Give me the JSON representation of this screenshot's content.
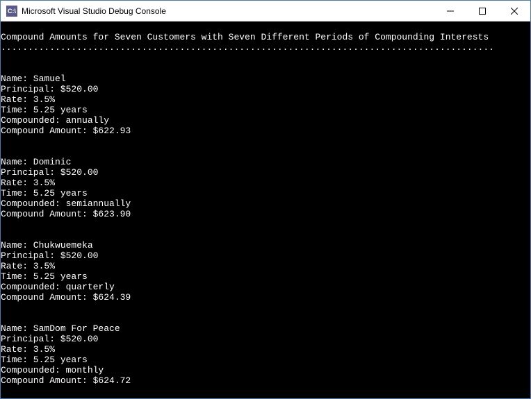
{
  "window": {
    "title": "Microsoft Visual Studio Debug Console",
    "icon_label": "C:\\"
  },
  "console": {
    "header": "Compound Amounts for Seven Customers with Seven Different Periods of Compounding Interests",
    "separator": "...........................................................................................",
    "labels": {
      "name": "Name: ",
      "principal": "Principal: ",
      "rate": "Rate: ",
      "time": "Time: ",
      "compounded": "Compounded: ",
      "amount": "Compound Amount: "
    },
    "customers": [
      {
        "name": "Samuel",
        "principal": "$520.00",
        "rate": "3.5%",
        "time": "5.25 years",
        "compounded": "annually",
        "amount": "$622.93"
      },
      {
        "name": "Dominic",
        "principal": "$520.00",
        "rate": "3.5%",
        "time": "5.25 years",
        "compounded": "semiannually",
        "amount": "$623.90"
      },
      {
        "name": "Chukwuemeka",
        "principal": "$520.00",
        "rate": "3.5%",
        "time": "5.25 years",
        "compounded": "quarterly",
        "amount": "$624.39"
      },
      {
        "name": "SamDom For Peace",
        "principal": "$520.00",
        "rate": "3.5%",
        "time": "5.25 years",
        "compounded": "monthly",
        "amount": "$624.72"
      }
    ]
  }
}
